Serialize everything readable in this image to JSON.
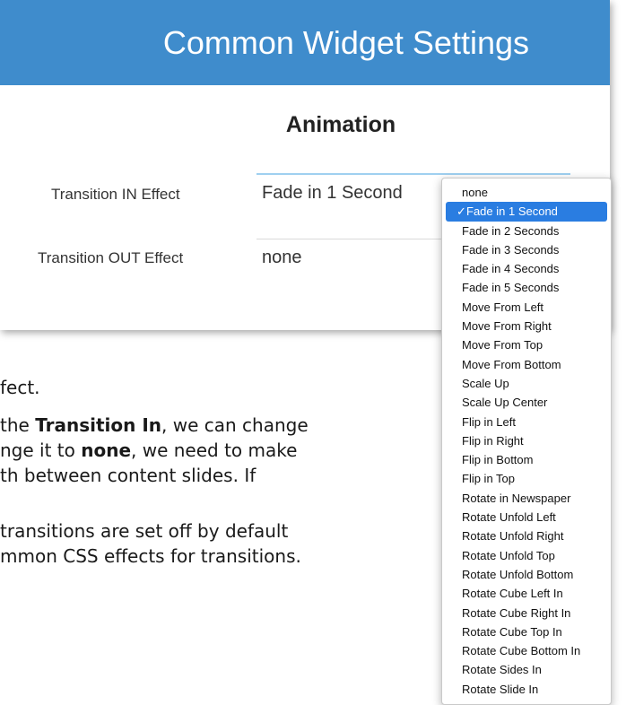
{
  "panel": {
    "title": "Common Widget Settings",
    "section": "Animation",
    "fields": [
      {
        "label": "Transition IN Effect",
        "value": "Fade in 1 Second"
      },
      {
        "label": "Transition OUT Effect",
        "value": "none"
      }
    ]
  },
  "dropdown": {
    "check_glyph": "✓",
    "selected": "Fade in 1 Second",
    "options": [
      "none",
      "Fade in 1 Second",
      "Fade in 2 Seconds",
      "Fade in 3 Seconds",
      "Fade in 4 Seconds",
      "Fade in 5 Seconds",
      "Move From Left",
      "Move From Right",
      "Move From Top",
      "Move From Bottom",
      "Scale Up",
      "Scale Up Center",
      "Flip in Left",
      "Flip in Right",
      "Flip in Bottom",
      "Flip in Top",
      "Rotate in Newspaper",
      "Rotate Unfold Left",
      "Rotate Unfold Right",
      "Rotate Unfold Top",
      "Rotate Unfold Bottom",
      "Rotate Cube Left In",
      "Rotate Cube Right In",
      "Rotate Cube Top In",
      "Rotate Cube Bottom In",
      "Rotate Sides In",
      "Rotate Slide In"
    ]
  },
  "document": {
    "line1": "fect.",
    "line2_pre": "the ",
    "line2_bold": "Transition In",
    "line2_post": ", we can change",
    "line3_pre": "nge it to ",
    "line3_bold": "none",
    "line3_post": ", we need to make",
    "line4": "th between content slides.  If",
    "line5": "transitions are set off by default",
    "line6": "mmon CSS effects for transitions."
  },
  "colors": {
    "header": "#3f8ccc",
    "selection": "#2a7de1",
    "input_focus": "#9fd0f0"
  }
}
